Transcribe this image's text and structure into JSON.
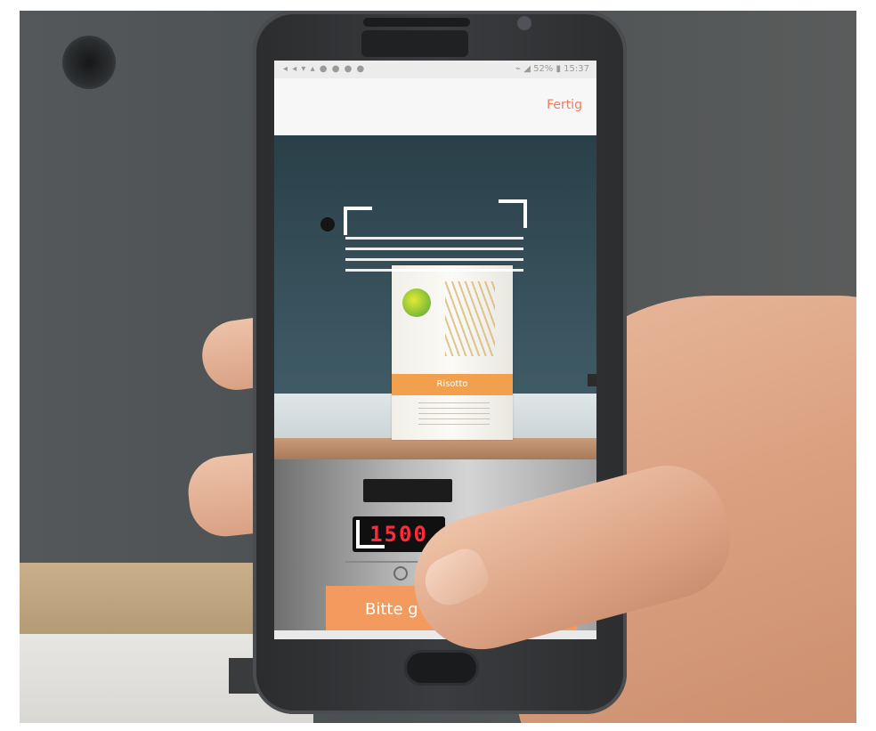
{
  "status_bar": {
    "left_icons": "◂ ◂ ▾ ▴ ● ● ● ●",
    "right_text": "⌁ ◢ 52% ▮ 15:37"
  },
  "app_bar": {
    "done_label": "Fertig"
  },
  "product": {
    "band_text": "Risotto"
  },
  "oven": {
    "display_text": "1500"
  },
  "cta": {
    "label": "Bitte g"
  },
  "icons": {
    "scan_frame": "corner-bracket-icon",
    "status": "status-icons"
  },
  "colors": {
    "accent": "#f37b5c",
    "cta": "#f39a5f",
    "oven_digits": "#ff2b3b"
  }
}
